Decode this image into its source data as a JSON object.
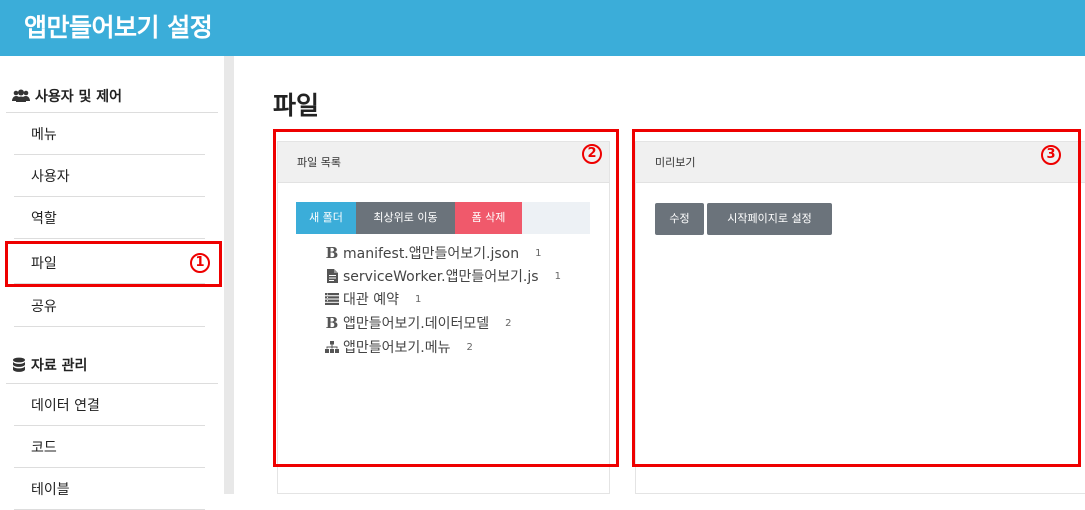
{
  "header": {
    "title": "앱만들어보기 설정"
  },
  "sidebar": {
    "sections": [
      {
        "title": "사용자 및 제어",
        "icon": "users-icon"
      },
      {
        "title": "자료 관리",
        "icon": "database-icon"
      }
    ],
    "items": [
      {
        "label": "메뉴"
      },
      {
        "label": "사용자"
      },
      {
        "label": "역할"
      },
      {
        "label": "파일"
      },
      {
        "label": "공유"
      },
      {
        "label": "데이터 연결"
      },
      {
        "label": "코드"
      },
      {
        "label": "테이블"
      }
    ]
  },
  "page": {
    "title": "파일"
  },
  "file_panel": {
    "title": "파일 목록",
    "buttons": {
      "new_folder": "새 폴더",
      "to_top": "최상위로 이동",
      "delete_form": "폼 삭제"
    },
    "files": [
      {
        "name": "manifest.앱만들어보기.json",
        "count": "1",
        "icon": "bold-b-icon"
      },
      {
        "name": "serviceWorker.앱만들어보기.js",
        "count": "1",
        "icon": "file-text-icon"
      },
      {
        "name": "대관 예약",
        "count": "1",
        "icon": "form-list-icon"
      },
      {
        "name": "앱만들어보기.데이터모델",
        "count": "2",
        "icon": "bold-b-icon"
      },
      {
        "name": "앱만들어보기.메뉴",
        "count": "2",
        "icon": "sitemap-icon"
      }
    ]
  },
  "preview_panel": {
    "title": "미리보기",
    "buttons": {
      "edit": "수정",
      "set_start": "시작페이지로 설정"
    }
  },
  "annotations": [
    "①",
    "②",
    "③"
  ],
  "colors": {
    "header": "#3badd9",
    "accent_red": "#ee0000",
    "btn_gray": "#6b737b",
    "btn_red": "#f0596b"
  }
}
